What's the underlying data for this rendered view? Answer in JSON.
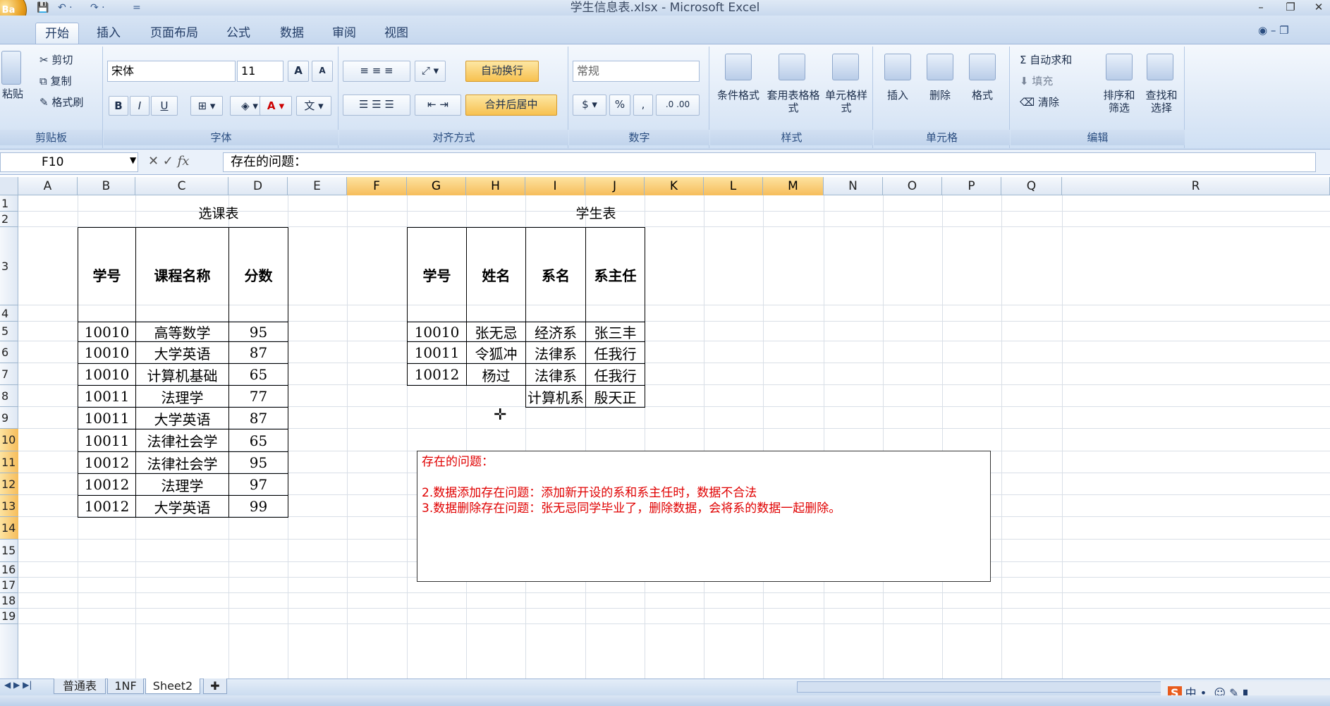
{
  "window": {
    "title": "学生信息表.xlsx - Microsoft Excel",
    "office_label": "Ba",
    "min": "–",
    "max": "❐",
    "close": "✕"
  },
  "qat": {
    "save": "💾",
    "undo": "↶ ·",
    "redo": "↷ ·",
    "more": "="
  },
  "tabs": [
    "开始",
    "插入",
    "页面布局",
    "公式",
    "数据",
    "审阅",
    "视图"
  ],
  "ribbon": {
    "clipboard": {
      "paste": "粘贴",
      "cut": "剪切",
      "copy": "复制",
      "format_painter": "格式刷",
      "label": "剪贴板"
    },
    "font": {
      "name": "宋体",
      "size": "11",
      "grow": "A",
      "shrink": "A",
      "bold": "B",
      "italic": "I",
      "underline": "U",
      "label": "字体"
    },
    "align": {
      "wrap": "自动换行",
      "merge": "合并后居中",
      "label": "对齐方式"
    },
    "number": {
      "format": "常规",
      "percent": "%",
      "comma": ",",
      "label": "数字"
    },
    "styles": {
      "cond": "条件格式",
      "table": "套用表格格式",
      "cell": "单元格样式",
      "label": "样式"
    },
    "cells": {
      "insert": "插入",
      "delete": "删除",
      "format": "格式",
      "label": "单元格"
    },
    "edit": {
      "autosum": "Σ 自动求和",
      "fill": "填充",
      "clear": "清除",
      "sort": "排序和筛选",
      "find": "查找和选择",
      "label": "编辑"
    }
  },
  "formula_bar": {
    "name_box": "F10",
    "fx": "fx",
    "content": "存在的问题："
  },
  "columns": [
    "A",
    "B",
    "C",
    "D",
    "E",
    "F",
    "G",
    "H",
    "I",
    "J",
    "K",
    "L",
    "M",
    "N",
    "O",
    "P",
    "Q",
    "R"
  ],
  "rows": [
    "1",
    "2",
    "3",
    "4",
    "5",
    "6",
    "7",
    "8",
    "9",
    "10",
    "11",
    "12",
    "13",
    "14",
    "15",
    "16",
    "17",
    "18",
    "19"
  ],
  "course_table": {
    "title": "选课表",
    "headers": [
      "学号",
      "课程名称",
      "分数"
    ],
    "rows": [
      [
        "10010",
        "高等数学",
        "95"
      ],
      [
        "10010",
        "大学英语",
        "87"
      ],
      [
        "10010",
        "计算机基础",
        "65"
      ],
      [
        "10011",
        "法理学",
        "77"
      ],
      [
        "10011",
        "大学英语",
        "87"
      ],
      [
        "10011",
        "法律社会学",
        "65"
      ],
      [
        "10012",
        "法律社会学",
        "95"
      ],
      [
        "10012",
        "法理学",
        "97"
      ],
      [
        "10012",
        "大学英语",
        "99"
      ]
    ]
  },
  "student_table": {
    "title": "学生表",
    "headers": [
      "学号",
      "姓名",
      "系名",
      "系主任"
    ],
    "rows": [
      [
        "10010",
        "张无忌",
        "经济系",
        "张三丰"
      ],
      [
        "10011",
        "令狐冲",
        "法律系",
        "任我行"
      ],
      [
        "10012",
        "杨过",
        "法律系",
        "任我行"
      ],
      [
        "",
        "",
        "计算机系",
        "殷天正"
      ]
    ]
  },
  "textbox": {
    "line1": "存在的问题：",
    "line2": "2.数据添加存在问题：添加新开设的系和系主任时，数据不合法",
    "line3": "3.数据删除存在问题：张无忌同学毕业了，删除数据，会将系的数据一起删除。"
  },
  "sheet_tabs": [
    "普通表",
    "1NF",
    "Sheet2"
  ],
  "active_sheet": "Sheet2"
}
